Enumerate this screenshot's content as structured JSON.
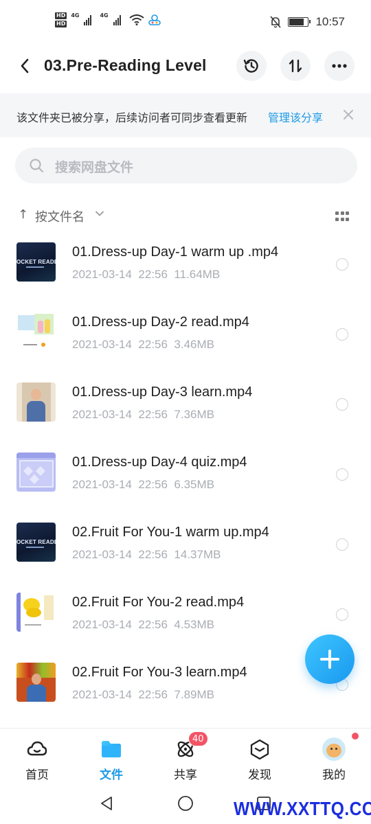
{
  "status_bar": {
    "hd1": "HD",
    "hd2": "HD",
    "net1": "4G",
    "net2": "4G",
    "time": "10:57",
    "battery_level": 0.85
  },
  "header": {
    "title": "03.Pre-Reading Level",
    "back_icon": "chevron-left-icon",
    "history_icon": "history-icon",
    "transfer_icon": "transfer-icon",
    "more_icon": "more-icon"
  },
  "notice": {
    "text": "该文件夹已被分享，后续访问者可同步查看更新",
    "link": "管理该分享",
    "close_icon": "close-icon"
  },
  "search": {
    "placeholder": "搜索网盘文件"
  },
  "sort": {
    "arrow": "↑",
    "label": "按文件名"
  },
  "files": [
    {
      "name": "01.Dress-up Day-1 warm up .mp4",
      "date": "2021-03-14",
      "time": "22:56",
      "size": "11.64MB",
      "thumb": "rocket",
      "thumb_text": "ROCKET READERS"
    },
    {
      "name": "01.Dress-up Day-2 read.mp4",
      "date": "2021-03-14",
      "time": "22:56",
      "size": "3.46MB",
      "thumb": "read1"
    },
    {
      "name": "01.Dress-up Day-3 learn.mp4",
      "date": "2021-03-14",
      "time": "22:56",
      "size": "7.36MB",
      "thumb": "learn1"
    },
    {
      "name": "01.Dress-up Day-4 quiz.mp4",
      "date": "2021-03-14",
      "time": "22:56",
      "size": "6.35MB",
      "thumb": "quiz"
    },
    {
      "name": "02.Fruit For You-1 warm up.mp4",
      "date": "2021-03-14",
      "time": "22:56",
      "size": "14.37MB",
      "thumb": "rocket",
      "thumb_text": "ROCKET READERS"
    },
    {
      "name": "02.Fruit For You-2 read.mp4",
      "date": "2021-03-14",
      "time": "22:56",
      "size": "4.53MB",
      "thumb": "fruit2"
    },
    {
      "name": "02.Fruit For You-3 learn.mp4",
      "date": "2021-03-14",
      "time": "22:56",
      "size": "7.89MB",
      "thumb": "learn2"
    }
  ],
  "fab": {
    "icon": "plus-icon"
  },
  "bottom_nav": [
    {
      "label": "首页",
      "icon": "home-cloud-icon",
      "active": false
    },
    {
      "label": "文件",
      "icon": "folder-icon",
      "active": true
    },
    {
      "label": "共享",
      "icon": "share-atom-icon",
      "active": false,
      "badge": "40"
    },
    {
      "label": "发现",
      "icon": "discover-cube-icon",
      "active": false
    },
    {
      "label": "我的",
      "icon": "avatar-icon",
      "active": false,
      "dot": true
    }
  ],
  "watermark": "WWW.XXTTQ.COM",
  "colors": {
    "accent": "#1c9ae6",
    "badge": "#f25466",
    "watermark": "#1b2de0"
  }
}
